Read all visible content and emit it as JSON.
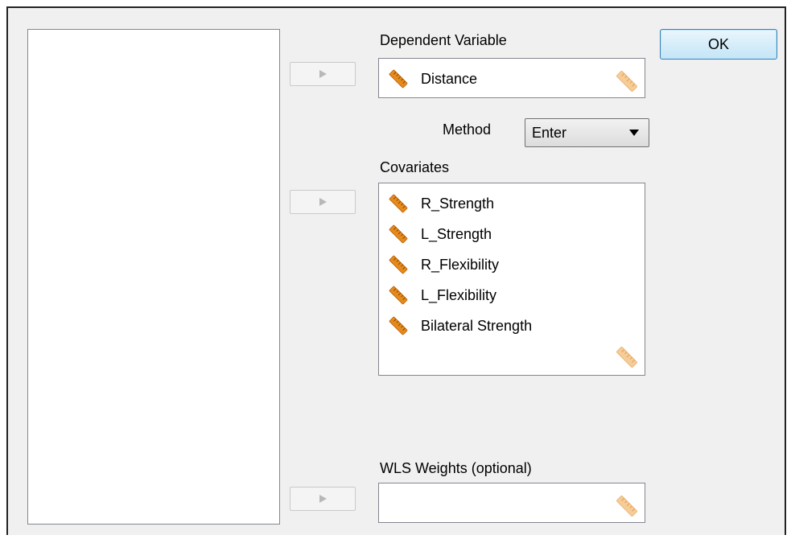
{
  "ok_button": {
    "label": "OK"
  },
  "dependent": {
    "label": "Dependent Variable",
    "value": "Distance",
    "value_icon": "scale-ruler-icon",
    "drop_icon": "scale-ruler-faded-icon"
  },
  "method": {
    "label": "Method",
    "selected": "Enter"
  },
  "covariates": {
    "label": "Covariates",
    "items": [
      {
        "name": "R_Strength",
        "icon": "scale-ruler-icon"
      },
      {
        "name": "L_Strength",
        "icon": "scale-ruler-icon"
      },
      {
        "name": "R_Flexibility",
        "icon": "scale-ruler-icon"
      },
      {
        "name": "L_Flexibility",
        "icon": "scale-ruler-icon"
      },
      {
        "name": "Bilateral Strength",
        "icon": "scale-ruler-icon"
      }
    ],
    "drop_icon": "scale-ruler-faded-icon"
  },
  "wls": {
    "label": "WLS Weights (optional)",
    "value": "",
    "drop_icon": "scale-ruler-faded-icon"
  },
  "move_button_icon": "right-arrow-icon",
  "colors": {
    "ruler": "#e68a1c",
    "ruler_faded": "#f6cc97",
    "dialog_bg": "#f0f0f0",
    "ok_border": "#3c7fb1"
  }
}
